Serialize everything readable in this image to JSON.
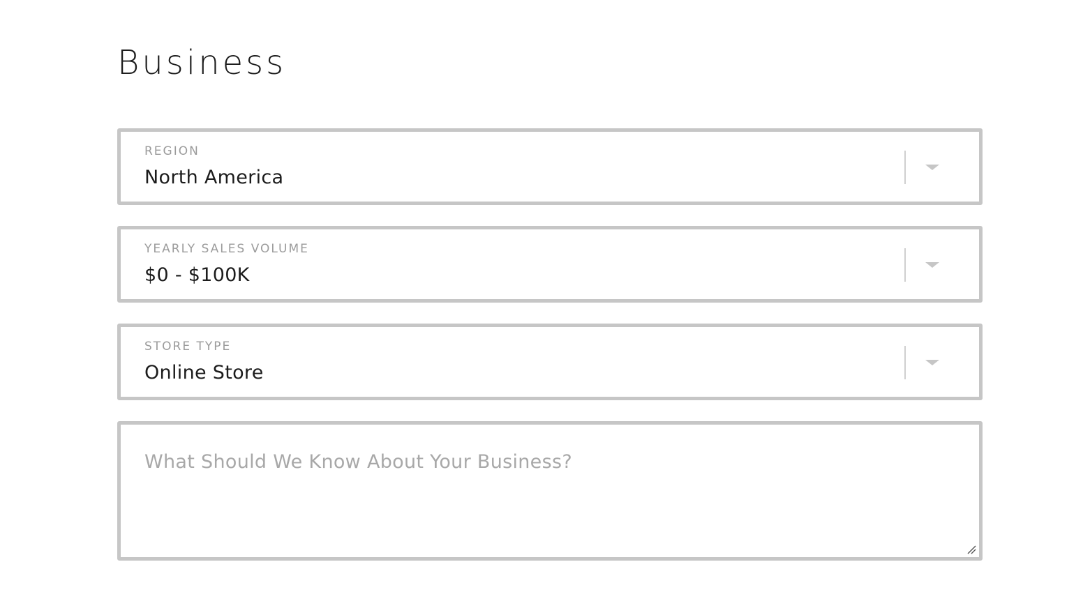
{
  "page": {
    "title": "Business"
  },
  "form": {
    "region": {
      "label": "REGION",
      "value": "North America"
    },
    "sales_volume": {
      "label": "YEARLY SALES VOLUME",
      "value": "$0 - $100K"
    },
    "store_type": {
      "label": "STORE TYPE",
      "value": "Online Store"
    },
    "about": {
      "placeholder": "What Should We Know About Your Business?",
      "value": ""
    }
  },
  "icons": {
    "dropdown": "chevron-down-icon",
    "resize": "resize-handle-icon"
  },
  "colors": {
    "border": "#c6c6c6",
    "label": "#9b9b9b",
    "text": "#1c1c1c",
    "placeholder": "#a8a8a8"
  }
}
